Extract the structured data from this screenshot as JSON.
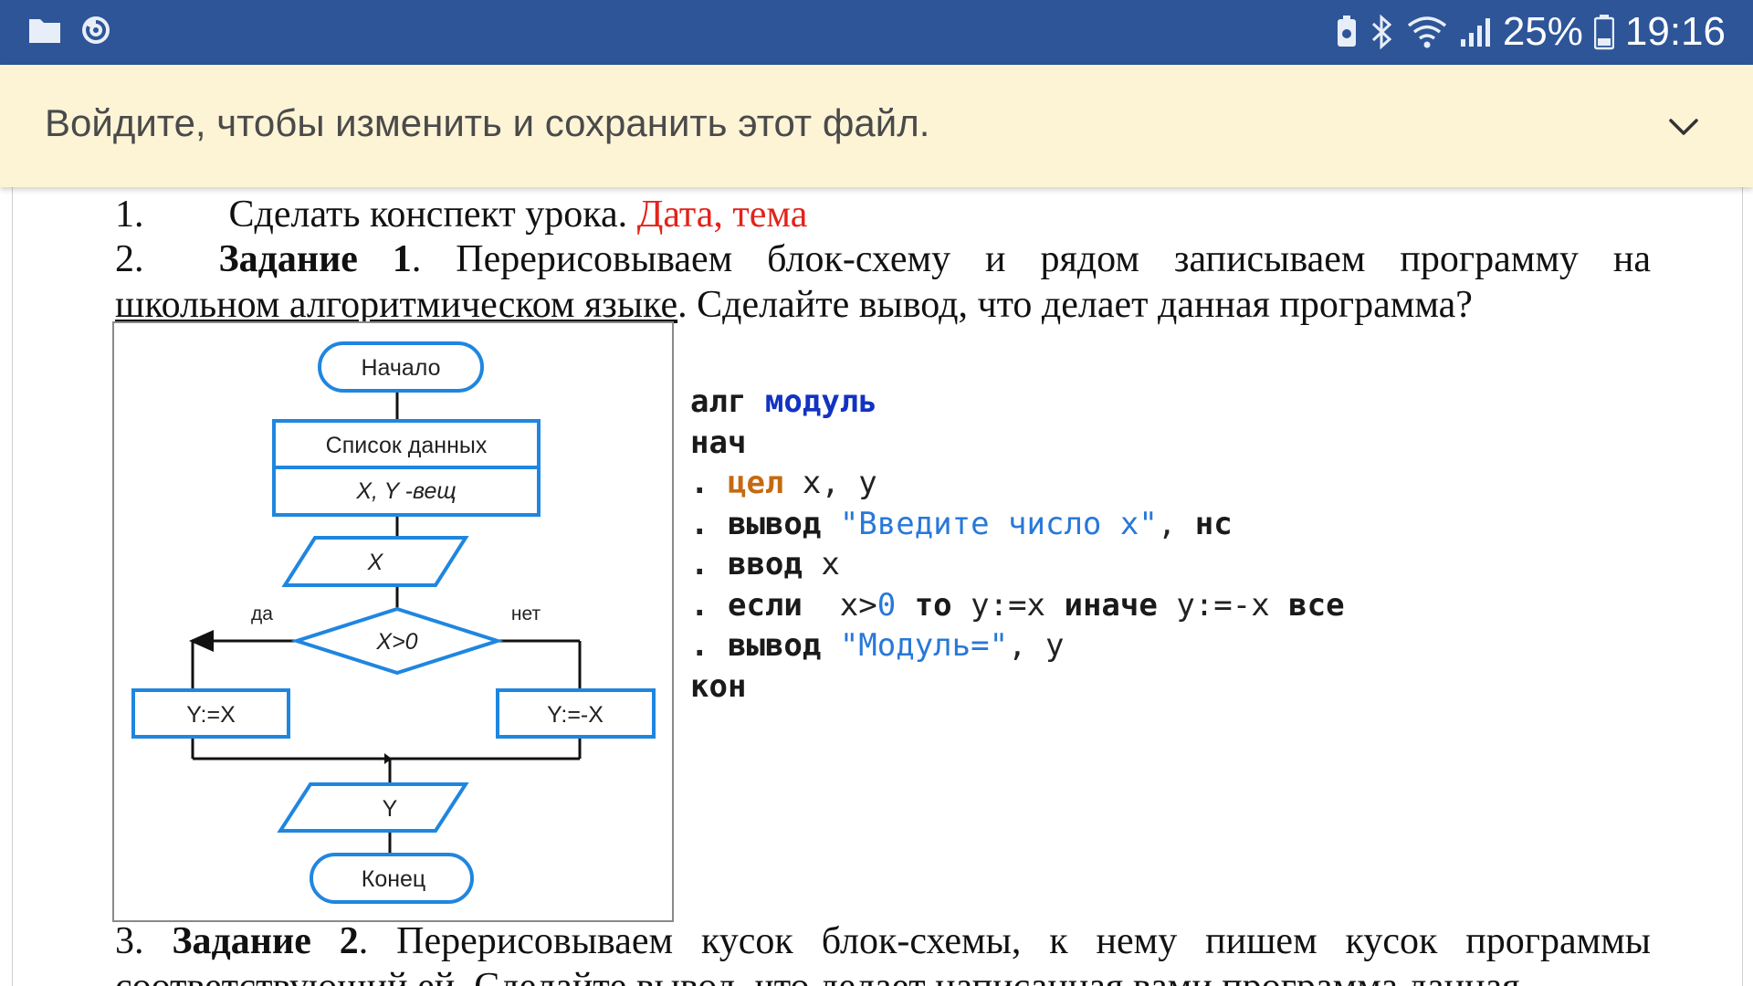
{
  "status_bar": {
    "battery_percent": "25%",
    "time": "19:16",
    "icons": [
      "folder-icon",
      "app-swirl-icon",
      "battery-saver-icon",
      "bluetooth-icon",
      "wifi-icon",
      "signal-icon",
      "battery-icon"
    ]
  },
  "banner": {
    "text": "Войдите, чтобы изменить и сохранить этот файл.",
    "icon": "chevron-down-icon"
  },
  "document": {
    "item1": {
      "number": "1.",
      "text": "Сделать конспект урока.",
      "red_text": "Дата, тема"
    },
    "item2": {
      "number": "2.",
      "bold": "Задание 1",
      "text_line1": ". Перерисовываем блок-схему и рядом записываем программу на",
      "text_line2_underlined": "школьном алгоритмическом языке",
      "text_line2_rest": ". Сделайте вывод, что делает данная программа?"
    },
    "flowchart": {
      "start": "Начало",
      "data_list": "Список данных",
      "vars": "X, Y -вещ",
      "input": "X",
      "condition": "X>0",
      "yes": "да",
      "no": "нет",
      "assign_yes": "Y:=X",
      "assign_no": "Y:=-X",
      "output": "Y",
      "end": "Конец"
    },
    "code": {
      "line1_kw": "алг",
      "line1_name": "модуль",
      "line2": "нач",
      "line3_type": "цел",
      "line3_rest": " x, y",
      "line4_kw": "вывод",
      "line4_str": "\"Введите число x\"",
      "line4_sep": ", ",
      "line4_nc": "нс",
      "line5_kw": "ввод",
      "line5_rest": " x",
      "line6_if": "если",
      "line6_cond_a": "  x>",
      "line6_zero": "0",
      "line6_then": " то",
      "line6_assign1": " y:=x",
      "line6_else": " иначе",
      "line6_assign2": " y:=-x",
      "line6_end": " все",
      "line7_kw": "вывод",
      "line7_str": "\"Модуль=\"",
      "line7_rest": ", y",
      "line8": "кон",
      "bullet": "."
    },
    "item3": {
      "number": "3.",
      "bold": "Задание 2",
      "text_line1": ". Перерисовываем кусок блок-схемы, к нему пишем кусок программы",
      "text_line2": "соответствующий ей. Сделайте вывод, что делает написанная вами программа данная"
    }
  }
}
